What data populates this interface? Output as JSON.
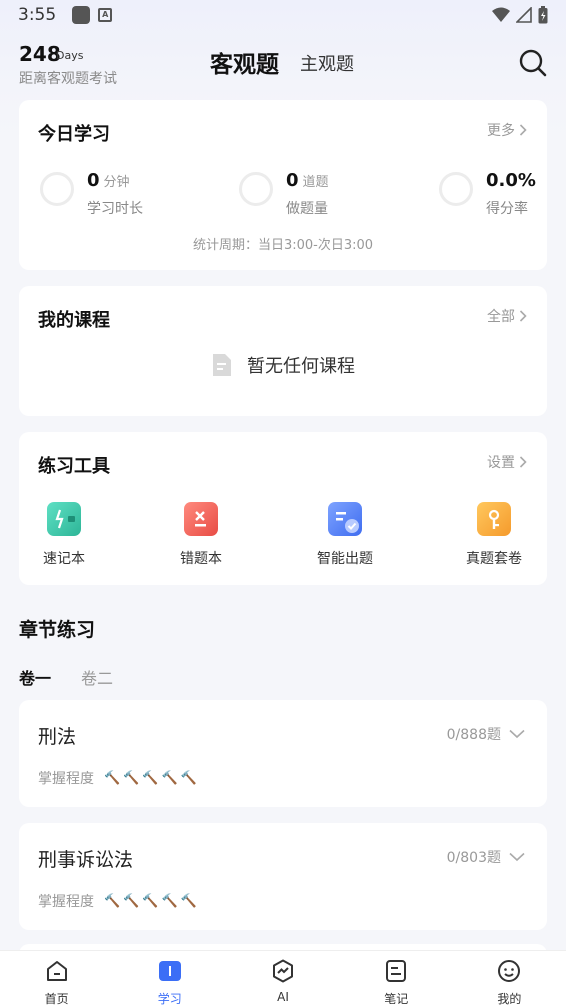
{
  "status_bar": {
    "time": "3:55"
  },
  "header": {
    "days_number": "248",
    "days_unit": "Days",
    "days_caption": "距离客观题考试",
    "tab_objective": "客观题",
    "tab_subjective": "主观题"
  },
  "today": {
    "title": "今日学习",
    "more": "更多",
    "stats": [
      {
        "value": "0",
        "unit": "分钟",
        "label": "学习时长"
      },
      {
        "value": "0",
        "unit": "道题",
        "label": "做题量"
      },
      {
        "value": "0.0%",
        "unit": "",
        "label": "得分率"
      }
    ],
    "period": "统计周期：当日3:00-次日3:00"
  },
  "courses": {
    "title": "我的课程",
    "more": "全部",
    "empty_text": "暂无任何课程"
  },
  "tools": {
    "title": "练习工具",
    "more": "设置",
    "items": [
      {
        "label": "速记本",
        "icon": "flashcard-icon",
        "color": "#37c8a8"
      },
      {
        "label": "错题本",
        "icon": "wrong-book-icon",
        "color": "#f0645a"
      },
      {
        "label": "智能出题",
        "icon": "smart-quiz-icon",
        "color": "#4b7cf5"
      },
      {
        "label": "真题套卷",
        "icon": "exam-paper-icon",
        "color": "#f7a93a"
      }
    ]
  },
  "chapters": {
    "title": "章节练习",
    "volume_tabs": [
      "卷一",
      "卷二"
    ],
    "mastery_label": "掌握程度",
    "items": [
      {
        "name": "刑法",
        "count": "0/888题"
      },
      {
        "name": "刑事诉讼法",
        "count": "0/803题"
      }
    ]
  },
  "tabbar": {
    "items": [
      {
        "label": "首页",
        "icon": "home-icon"
      },
      {
        "label": "学习",
        "icon": "study-icon"
      },
      {
        "label": "AI",
        "icon": "ai-icon"
      },
      {
        "label": "笔记",
        "icon": "notes-icon"
      },
      {
        "label": "我的",
        "icon": "profile-icon"
      }
    ],
    "active_color": "#3b6ef6"
  }
}
